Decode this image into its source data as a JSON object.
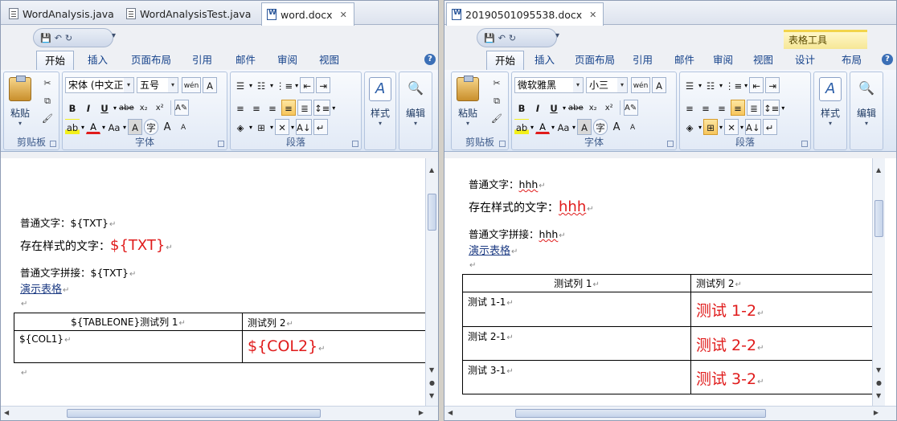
{
  "left": {
    "editor_tabs": [
      {
        "label": "WordAnalysis.java",
        "icon": "java-file-icon"
      },
      {
        "label": "WordAnalysisTest.java",
        "icon": "java-file-icon"
      },
      {
        "label": "word.docx",
        "icon": "word-file-icon",
        "active": true
      }
    ],
    "ribbon_tabs": [
      "开始",
      "插入",
      "页面布局",
      "引用",
      "邮件",
      "审阅",
      "视图"
    ],
    "font_name": "宋体 (中文正文",
    "font_size": "五号",
    "groups": {
      "clipboard": "剪贴板",
      "font": "字体",
      "paragraph": "段落"
    },
    "paste_label": "粘贴",
    "styles_label": "样式",
    "edit_label": "编辑",
    "doc": {
      "line1_label": "普通文字：",
      "line1_value": "${TXT}",
      "line2_label": "存在样式的文字：",
      "line2_value": "${TXT}",
      "line3_label": "普通文字拼接：",
      "line3_value": "${TXT}",
      "link": "演示表格",
      "table": {
        "headers": [
          "${TABLEONE}测试列 1",
          "测试列 2"
        ],
        "rows": [
          [
            "${COL1}",
            "${COL2}"
          ]
        ]
      }
    }
  },
  "right": {
    "editor_tabs": [
      {
        "label": "20190501095538.docx",
        "icon": "word-file-icon",
        "active": true
      }
    ],
    "context_tool": "表格工具",
    "ribbon_tabs": [
      "开始",
      "插入",
      "页面布局",
      "引用",
      "邮件",
      "审阅",
      "视图",
      "设计",
      "布局"
    ],
    "font_name": "微软雅黑",
    "font_size": "小三",
    "groups": {
      "clipboard": "剪贴板",
      "font": "字体",
      "paragraph": "段落"
    },
    "paste_label": "粘贴",
    "styles_label": "样式",
    "edit_label": "编辑",
    "doc": {
      "line1_label": "普通文字：",
      "line1_value": "hhh",
      "line2_label": "存在样式的文字：",
      "line2_value": "hhh",
      "line3_label": "普通文字拼接：",
      "line3_value": "hhh",
      "link": "演示表格",
      "table": {
        "headers": [
          "测试列 1",
          "测试列 2"
        ],
        "rows": [
          [
            "测试 1-1",
            "测试 1-2"
          ],
          [
            "测试 2-1",
            "测试 2-2"
          ],
          [
            "测试 3-1",
            "测试 3-2"
          ]
        ]
      }
    }
  },
  "font_toolbar": {
    "bold": "B",
    "italic": "I",
    "underline": "U",
    "strike": "abe",
    "subscript": "x₂",
    "superscript": "x²",
    "font_color": "A",
    "case": "Aa",
    "grow": "A",
    "shrink": "A"
  },
  "colors": {
    "accent": "#15428b",
    "red_text": "#e01b1b",
    "ribbon_bg": "#dce6f4",
    "context_tab": "#f6e796"
  }
}
